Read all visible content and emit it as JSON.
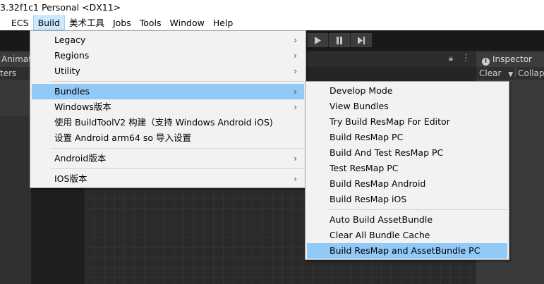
{
  "window": {
    "title": "3.32f1c1 Personal <DX11>"
  },
  "menubar": {
    "items": [
      "ECS",
      "Build",
      "美术工具",
      "Jobs",
      "Tools",
      "Window",
      "Help"
    ],
    "active": "Build"
  },
  "editor": {
    "left_tab": "Animato",
    "left_sub": "ters",
    "inspector_tab": "Inspector",
    "inspector_clear": "Clear",
    "inspector_collapse": "Collap"
  },
  "build_menu": {
    "items": [
      {
        "label": "Legacy",
        "submenu": true
      },
      {
        "label": "Regions",
        "submenu": true
      },
      {
        "label": "Utility",
        "submenu": true
      },
      {
        "label": "Bundles",
        "submenu": true,
        "highlighted": true
      },
      {
        "label": "Windows版本",
        "submenu": true
      },
      {
        "label": "使用 BuildToolV2 构建（支持 Windows Android iOS)",
        "submenu": false
      },
      {
        "label": "设置 Android arm64 so 导入设置",
        "submenu": false
      },
      {
        "label": "Android版本",
        "submenu": true
      },
      {
        "label": "IOS版本",
        "submenu": true
      }
    ]
  },
  "bundles_menu": {
    "items": [
      {
        "label": "Develop Mode"
      },
      {
        "label": "View Bundles"
      },
      {
        "label": "Try Build ResMap For Editor"
      },
      {
        "label": "Build ResMap PC"
      },
      {
        "label": "Build And Test ResMap PC"
      },
      {
        "label": "Test ResMap PC"
      },
      {
        "label": "Build ResMap Android"
      },
      {
        "label": "Build ResMap iOS"
      },
      {
        "label": "Auto Build AssetBundle"
      },
      {
        "label": "Clear All Bundle Cache"
      },
      {
        "label": "Build ResMap and AssetBundle PC",
        "highlighted": true
      }
    ]
  },
  "colors": {
    "menu_bg": "#f2f2f2",
    "highlight": "#91c9f7",
    "menubar_active": "#cce8ff"
  }
}
